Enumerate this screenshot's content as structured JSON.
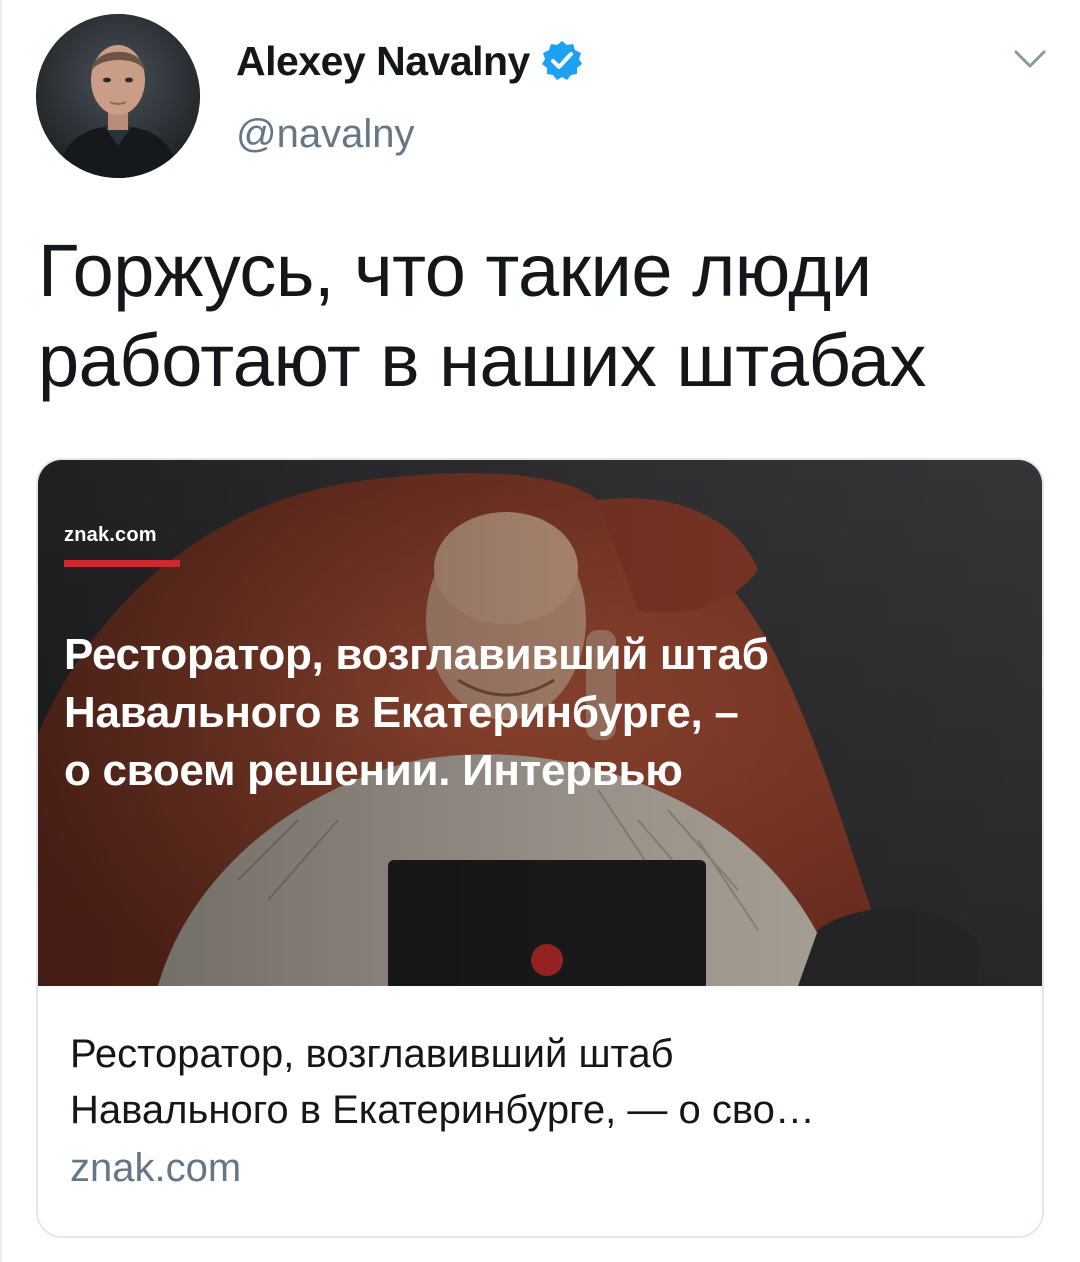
{
  "tweet": {
    "author": {
      "display_name": "Alexey Navalny",
      "handle": "@navalny",
      "verified": true
    },
    "text": "Горжусь, что такие люди работают в наших штабах",
    "text_lines": [
      "Горжусь, что такие люди",
      "работают в наших штабах"
    ]
  },
  "card": {
    "image": {
      "source_label": "znak.com",
      "headline_lines": [
        "Ресторатор, возглавивший штаб",
        "Навального в Екатеринбурге, –",
        "о своем решении. Интервью"
      ]
    },
    "title_lines": [
      "Ресторатор, возглавивший штаб",
      "Навального в Екатеринбурге, — о сво…"
    ],
    "domain": "znak.com"
  },
  "icons": {
    "verified": "verified-badge-icon",
    "menu": "chevron-down-icon"
  },
  "colors": {
    "verified_blue": "#1da1f2",
    "secondary_text": "#657786",
    "accent_red": "#d0262e"
  }
}
